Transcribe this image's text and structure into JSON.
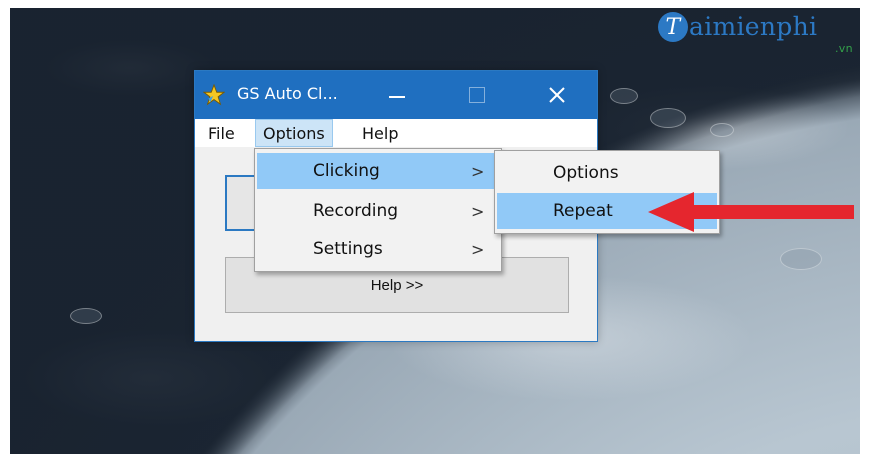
{
  "watermark": {
    "brand_initial": "T",
    "brand_rest": "aimienphi",
    "suffix": ".vn",
    "color": "#2c79c4"
  },
  "window": {
    "title": "GS Auto Cl...",
    "app_icon": "star-icon",
    "controls": {
      "minimize": "—",
      "maximize": "□",
      "close": "✕"
    },
    "accent": "#1f6fc0"
  },
  "menubar": {
    "items": [
      {
        "label": "File"
      },
      {
        "label": "Options"
      },
      {
        "label": "Help"
      }
    ]
  },
  "client": {
    "help_button": "Help >>"
  },
  "options_menu": {
    "items": [
      {
        "label": "Clicking",
        "submenu_arrow": ">"
      },
      {
        "label": "Recording",
        "submenu_arrow": ">"
      },
      {
        "label": "Settings",
        "submenu_arrow": ">"
      }
    ],
    "highlight": "#91c9f7"
  },
  "clicking_submenu": {
    "items": [
      {
        "label": "Options"
      },
      {
        "label": "Repeat"
      }
    ]
  },
  "annotation": {
    "arrow_color": "#e5262e"
  }
}
